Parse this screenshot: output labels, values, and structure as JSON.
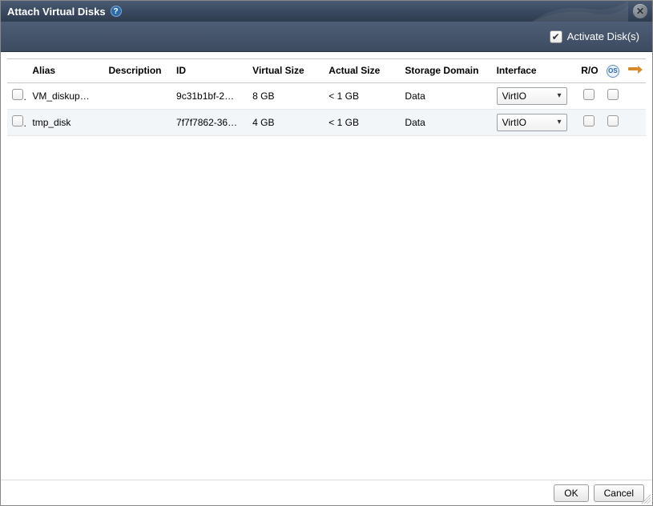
{
  "dialog": {
    "title": "Attach Virtual Disks",
    "help_symbol": "?",
    "close_symbol": "✕"
  },
  "toolbar": {
    "activate_label": "Activate Disk(s)",
    "activate_checked": true
  },
  "columns": {
    "alias": "Alias",
    "description": "Description",
    "id": "ID",
    "virtual_size": "Virtual Size",
    "actual_size": "Actual Size",
    "storage_domain": "Storage Domain",
    "interface": "Interface",
    "ro": "R/O",
    "os": "OS",
    "boot": ""
  },
  "rows": [
    {
      "alias": "VM_diskup…",
      "description": "",
      "id": "9c31b1bf-2…",
      "virtual_size": "8 GB",
      "actual_size": "< 1 GB",
      "storage_domain": "Data",
      "interface": "VirtIO"
    },
    {
      "alias": "tmp_disk",
      "description": "",
      "id": "7f7f7862-36…",
      "virtual_size": "4 GB",
      "actual_size": "< 1 GB",
      "storage_domain": "Data",
      "interface": "VirtIO"
    }
  ],
  "buttons": {
    "ok": "OK",
    "cancel": "Cancel"
  }
}
